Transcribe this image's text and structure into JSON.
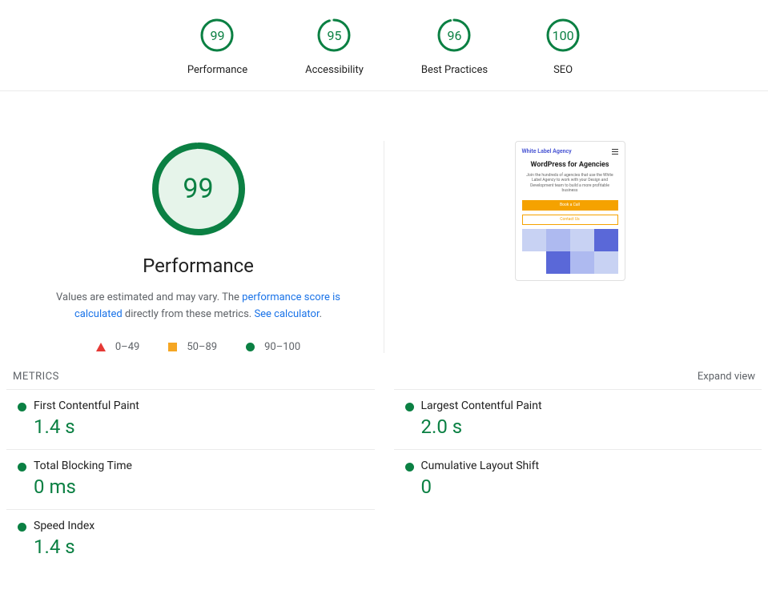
{
  "summary": [
    {
      "score": 99,
      "label": "Performance"
    },
    {
      "score": 95,
      "label": "Accessibility"
    },
    {
      "score": 96,
      "label": "Best Practices"
    },
    {
      "score": 100,
      "label": "SEO"
    }
  ],
  "main": {
    "score": 99,
    "title": "Performance",
    "desc_prefix": "Values are estimated and may vary. The ",
    "link1": "performance score is calculated",
    "desc_mid": " directly from these metrics. ",
    "link2": "See calculator",
    "desc_suffix": "."
  },
  "legend": {
    "r1": "0–49",
    "r2": "50–89",
    "r3": "90–100"
  },
  "thumb": {
    "logo": "White Label Agency",
    "title": "WordPress for Agencies",
    "sub": "Join the hundreds of agencies that use the White Label Agency to work with your Design and Development team to build a more profitable business",
    "btn1": "Book a Call",
    "btn2": "Contact Us"
  },
  "metrics_header": {
    "title": "METRICS",
    "expand": "Expand view"
  },
  "metrics": [
    {
      "label": "First Contentful Paint",
      "value": "1.4 s"
    },
    {
      "label": "Largest Contentful Paint",
      "value": "2.0 s"
    },
    {
      "label": "Total Blocking Time",
      "value": "0 ms"
    },
    {
      "label": "Cumulative Layout Shift",
      "value": "0"
    },
    {
      "label": "Speed Index",
      "value": "1.4 s"
    }
  ],
  "colors": {
    "pass": "#0b8043",
    "passFill": "#e6f4ea"
  }
}
